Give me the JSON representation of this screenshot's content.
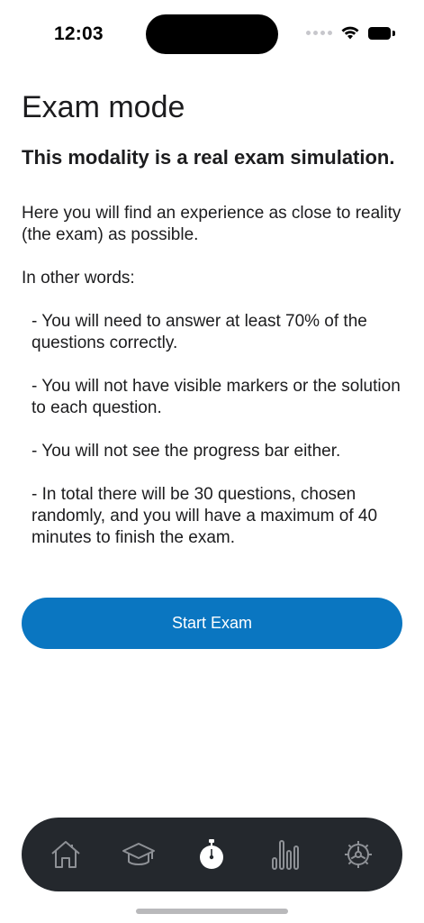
{
  "status_bar": {
    "time": "12:03"
  },
  "page": {
    "title": "Exam mode",
    "subtitle": "This modality is a real exam simulation.",
    "intro": "Here you will find an experience as close to reality (the exam) as possible.",
    "lead": "In other words:",
    "bullets": [
      "- You will need to answer at least 70% of the questions correctly.",
      "- You will not have visible markers or the solution to each question.",
      "- You will not see the progress bar either.",
      "- In total there will be 30 questions, chosen randomly, and you will have a maximum of 40 minutes to finish the exam."
    ]
  },
  "start_button": {
    "label": "Start Exam",
    "color": "#0A76C1"
  },
  "tab_bar": {
    "background": "#24282D",
    "active_index": 2,
    "tabs": [
      {
        "icon": "home-icon"
      },
      {
        "icon": "graduation-cap-icon"
      },
      {
        "icon": "stopwatch-icon"
      },
      {
        "icon": "bar-chart-icon"
      },
      {
        "icon": "gear-icon"
      }
    ]
  }
}
